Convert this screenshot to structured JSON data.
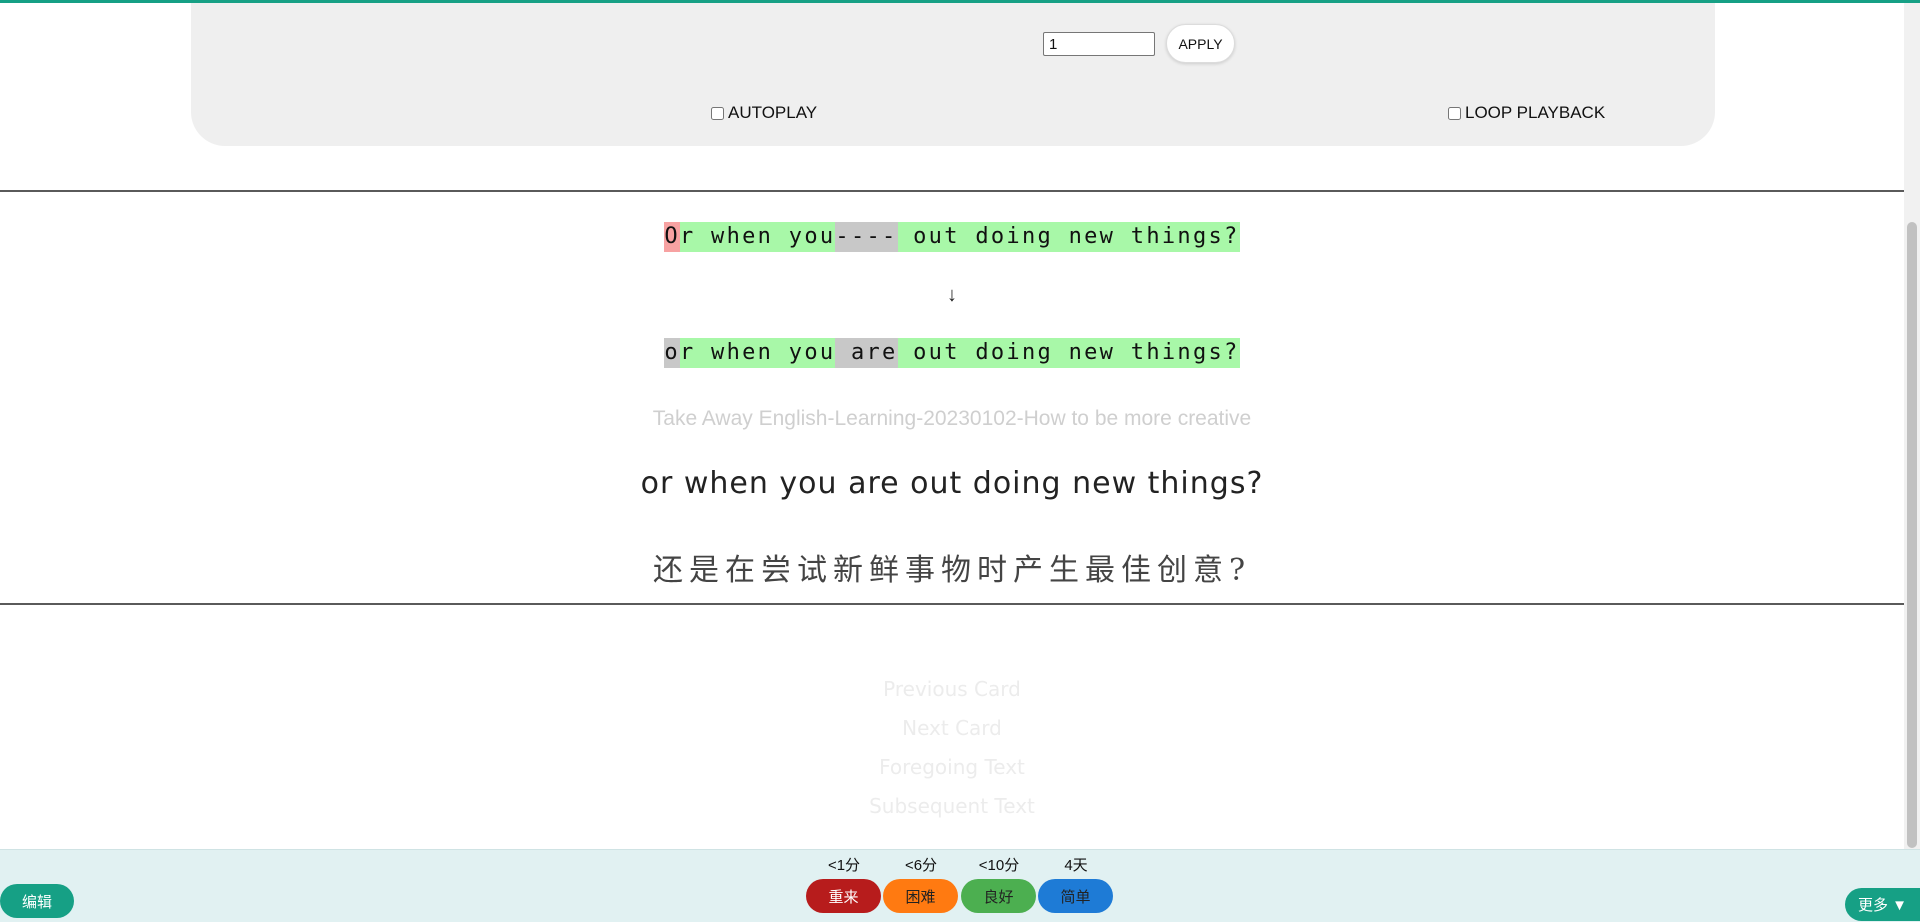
{
  "controls": {
    "speed_value": "1",
    "apply_label": "APPLY",
    "autoplay_label": "AUTOPLAY",
    "loop_label": "LOOP PLAYBACK",
    "autoplay_checked": false,
    "loop_checked": false
  },
  "comparison": {
    "typed_segments": [
      {
        "text": "O",
        "status": "wrong"
      },
      {
        "text": "r when you",
        "status": "ok"
      },
      {
        "text": "----",
        "status": "miss"
      },
      {
        "text": " out doing new things?",
        "status": "ok"
      }
    ],
    "arrow": "↓",
    "answer_segments": [
      {
        "text": "o",
        "status": "miss"
      },
      {
        "text": "r when you",
        "status": "ok"
      },
      {
        "text": " are",
        "status": "miss"
      },
      {
        "text": " out doing new things?",
        "status": "ok"
      }
    ]
  },
  "card": {
    "source_title": "Take Away English-Learning-20230102-How to be more creative",
    "sentence_en": "or when you are out doing new things?",
    "sentence_zh": "还是在尝试新鲜事物时产生最佳创意?"
  },
  "navigation": {
    "previous_card": "Previous Card",
    "next_card": "Next Card",
    "foregoing_text": "Foregoing Text",
    "subsequent_text": "Subsequent Text"
  },
  "bottom_bar": {
    "edit_label": "编辑",
    "more_label": "更多 ▼",
    "again": {
      "interval": "<1分",
      "label": "重来"
    },
    "hard": {
      "interval": "<6分",
      "label": "困难"
    },
    "good": {
      "interval": "<10分",
      "label": "良好"
    },
    "easy": {
      "interval": "4天",
      "label": "简单"
    }
  },
  "colors": {
    "accent": "#16a085",
    "correct_highlight": "#a8f8a8",
    "wrong_highlight": "#f7a2a2",
    "missing_highlight": "#c8c8c8",
    "again": "#b71c1c",
    "hard": "#ff7a11",
    "good": "#4caf50",
    "easy": "#1e7bd6"
  }
}
